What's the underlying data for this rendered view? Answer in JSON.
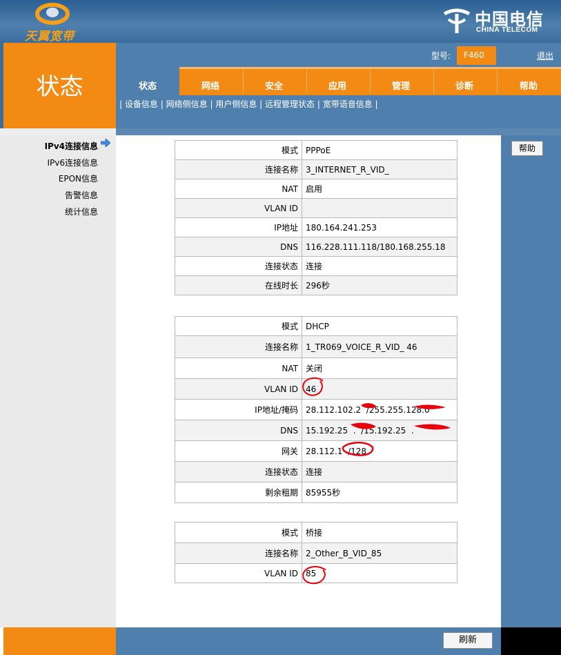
{
  "brand": {
    "left_logo_text": "天翼宽带",
    "right_logo_cn": "中国电信",
    "right_logo_en": "CHINA TELECOM"
  },
  "header": {
    "page_title": "状态",
    "model_label": "型号:",
    "model_value": "F460",
    "logout_label": "退出"
  },
  "tabs": [
    {
      "label": "状态"
    },
    {
      "label": "网络"
    },
    {
      "label": "安全"
    },
    {
      "label": "应用"
    },
    {
      "label": "管理"
    },
    {
      "label": "诊断"
    },
    {
      "label": "帮助"
    }
  ],
  "subnav": {
    "separator": "|",
    "items": [
      "设备信息",
      "网络侧信息",
      "用户侧信息",
      "远程管理状态",
      "宽带语音信息"
    ]
  },
  "sidebar": {
    "items": [
      {
        "label": "IPv4连接信息"
      },
      {
        "label": "IPv6连接信息"
      },
      {
        "label": "EPON信息"
      },
      {
        "label": "告警信息"
      },
      {
        "label": "统计信息"
      }
    ]
  },
  "help_button": "帮助",
  "refresh_button": "刷新",
  "connections": [
    {
      "rows": [
        {
          "key": "模式",
          "value": "PPPoE"
        },
        {
          "key": "连接名称",
          "value": "3_INTERNET_R_VID_"
        },
        {
          "key": "NAT",
          "value": "启用"
        },
        {
          "key": "VLAN ID",
          "value": ""
        },
        {
          "key": "IP地址",
          "value": "180.164.241.253"
        },
        {
          "key": "DNS",
          "value": "116.228.111.118/180.168.255.18"
        },
        {
          "key": "连接状态",
          "value": "连接"
        },
        {
          "key": "在线时长",
          "value": "296秒"
        }
      ]
    },
    {
      "rows": [
        {
          "key": "模式",
          "value": "DHCP"
        },
        {
          "key": "连接名称",
          "value": "1_TR069_VOICE_R_VID_ 46"
        },
        {
          "key": "NAT",
          "value": "关闭"
        },
        {
          "key": "VLAN ID",
          "value": "46"
        },
        {
          "key": "IP地址/掩码",
          "value": "28.112.102.2  /255.255.128.0"
        },
        {
          "key": "DNS",
          "value": "15.192.25  .  /15.192.25  .  "
        },
        {
          "key": "网关",
          "value": "28.112.1  /128"
        },
        {
          "key": "连接状态",
          "value": "连接"
        },
        {
          "key": "剩余租期",
          "value": "85955秒"
        }
      ]
    },
    {
      "rows": [
        {
          "key": "模式",
          "value": "桥接"
        },
        {
          "key": "连接名称",
          "value": "2_Other_B_VID_85"
        },
        {
          "key": "VLAN ID",
          "value": "85"
        }
      ]
    }
  ],
  "colors": {
    "orange": "#f28a13",
    "blue": "#4f80ad",
    "redaction": "#e8000b"
  }
}
